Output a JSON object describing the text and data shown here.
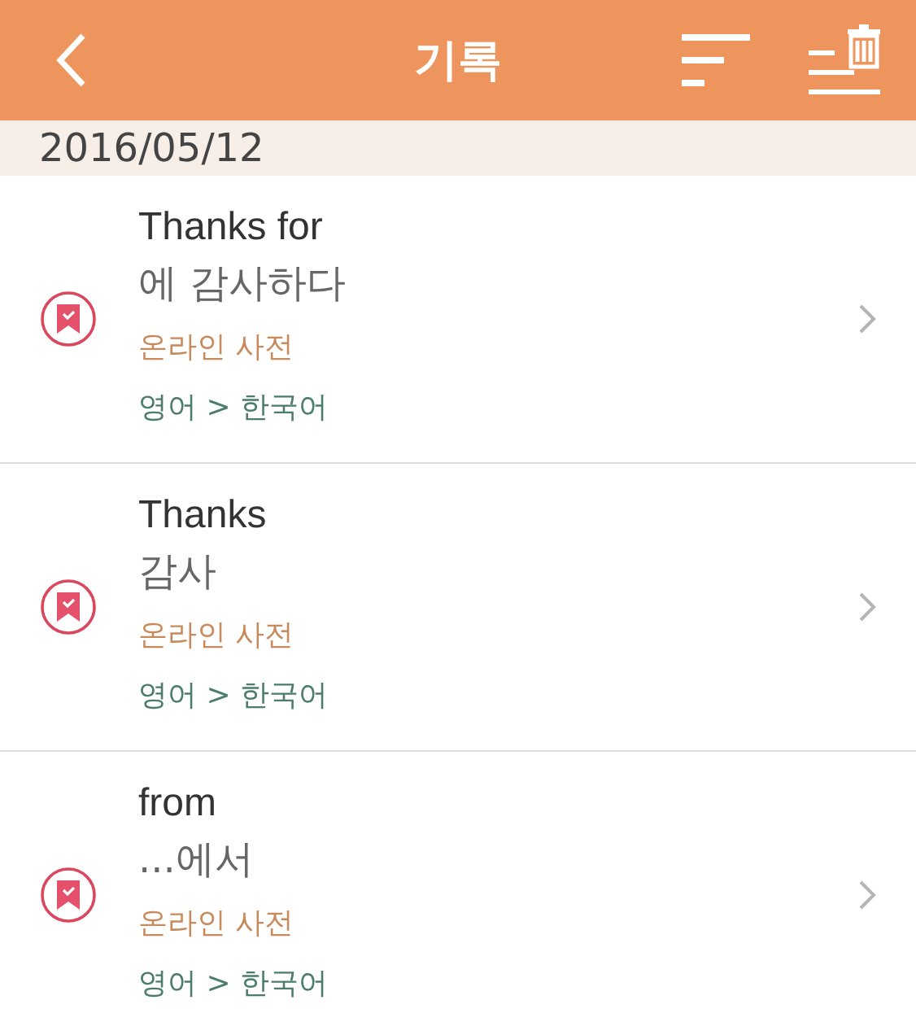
{
  "header": {
    "title": "기록"
  },
  "section": {
    "date": "2016/05/12"
  },
  "entries": [
    {
      "word": "Thanks for",
      "meaning": "에 감사하다",
      "source": "온라인 사전",
      "languages": "영어 > 한국어"
    },
    {
      "word": "Thanks",
      "meaning": "감사",
      "source": "온라인 사전",
      "languages": "영어 > 한국어"
    },
    {
      "word": "from",
      "meaning": "...에서",
      "source": "온라인 사전",
      "languages": "영어 > 한국어"
    }
  ]
}
